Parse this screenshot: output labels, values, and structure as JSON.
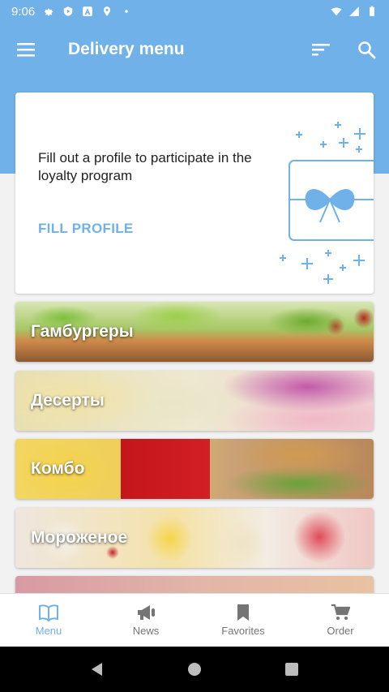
{
  "status_bar": {
    "time": "9:06",
    "icons": [
      "gear-icon",
      "play-shield-icon",
      "a-icon",
      "location-icon",
      "dot-icon"
    ],
    "right_icons": [
      "wifi-icon",
      "signal-icon",
      "battery-icon"
    ]
  },
  "app_bar": {
    "title": "Delivery menu",
    "menu_icon": "hamburger-icon",
    "sort_icon": "sort-icon",
    "search_icon": "search-icon"
  },
  "profile_card": {
    "message": "Fill out a profile to participate in the loyalty program",
    "cta": "FILL PROFILE",
    "illustration": "gift-card-icon"
  },
  "categories": [
    {
      "label": "Гамбургеры"
    },
    {
      "label": "Десерты"
    },
    {
      "label": "Комбо"
    },
    {
      "label": "Мороженое"
    },
    {
      "label": ""
    }
  ],
  "bottom_nav": {
    "items": [
      {
        "label": "Menu",
        "icon": "book-icon",
        "active": true
      },
      {
        "label": "News",
        "icon": "megaphone-icon",
        "active": false
      },
      {
        "label": "Favorites",
        "icon": "bookmark-icon",
        "active": false
      },
      {
        "label": "Order",
        "icon": "cart-icon",
        "active": false
      }
    ]
  },
  "system_nav": [
    "back-icon",
    "home-icon",
    "recents-icon"
  ],
  "colors": {
    "primary": "#6fb1e8",
    "nav_inactive": "#757575",
    "background": "#f2f2f2"
  }
}
